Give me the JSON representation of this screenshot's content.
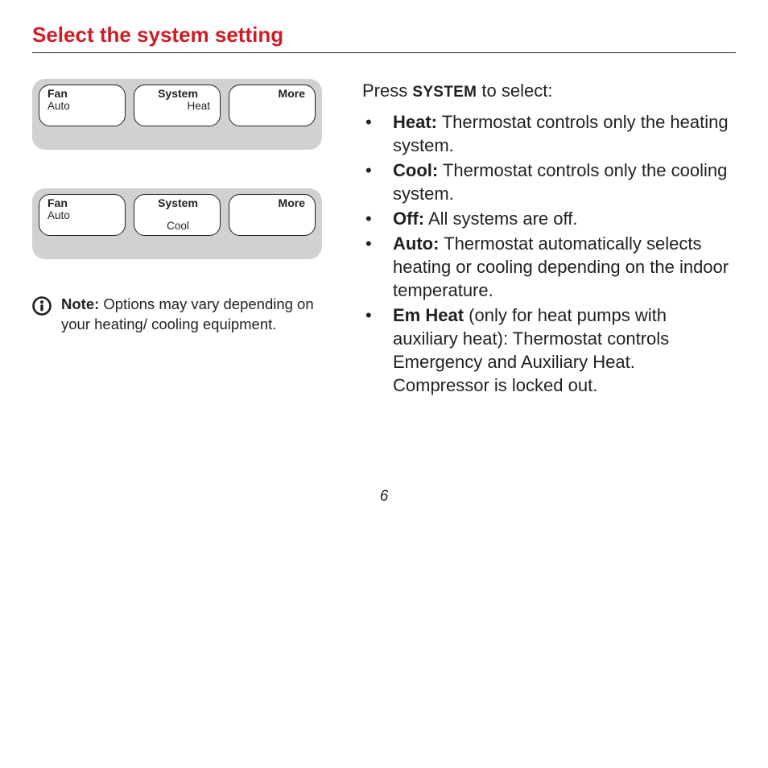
{
  "heading": "Select the system setting",
  "panels": [
    {
      "fan_label": "Fan",
      "fan_value": "Auto",
      "system_label": "System",
      "system_value": "Heat",
      "more_label": "More"
    },
    {
      "fan_label": "Fan",
      "fan_value": "Auto",
      "system_label": "System",
      "system_value": "Cool",
      "more_label": "More"
    }
  ],
  "note": {
    "label": "Note:",
    "text": "Options may vary depending on your heating/ cooling equipment."
  },
  "intro": {
    "pre": "Press ",
    "button": "SYSTEM",
    "post": " to select:"
  },
  "items": [
    {
      "label": "Heat:",
      "text": " Thermostat controls only the heating system."
    },
    {
      "label": "Cool:",
      "text": " Thermostat controls only the cooling system."
    },
    {
      "label": "Off:",
      "text": " All systems are off."
    },
    {
      "label": "Auto:",
      "text": " Thermostat automatically selects heating or cooling depending on the indoor temperature."
    },
    {
      "label": "Em Heat",
      "text": " (only for heat pumps with auxiliary heat): Thermostat controls Emergency and Auxiliary Heat. Compressor is locked out."
    }
  ],
  "page_number": "6"
}
